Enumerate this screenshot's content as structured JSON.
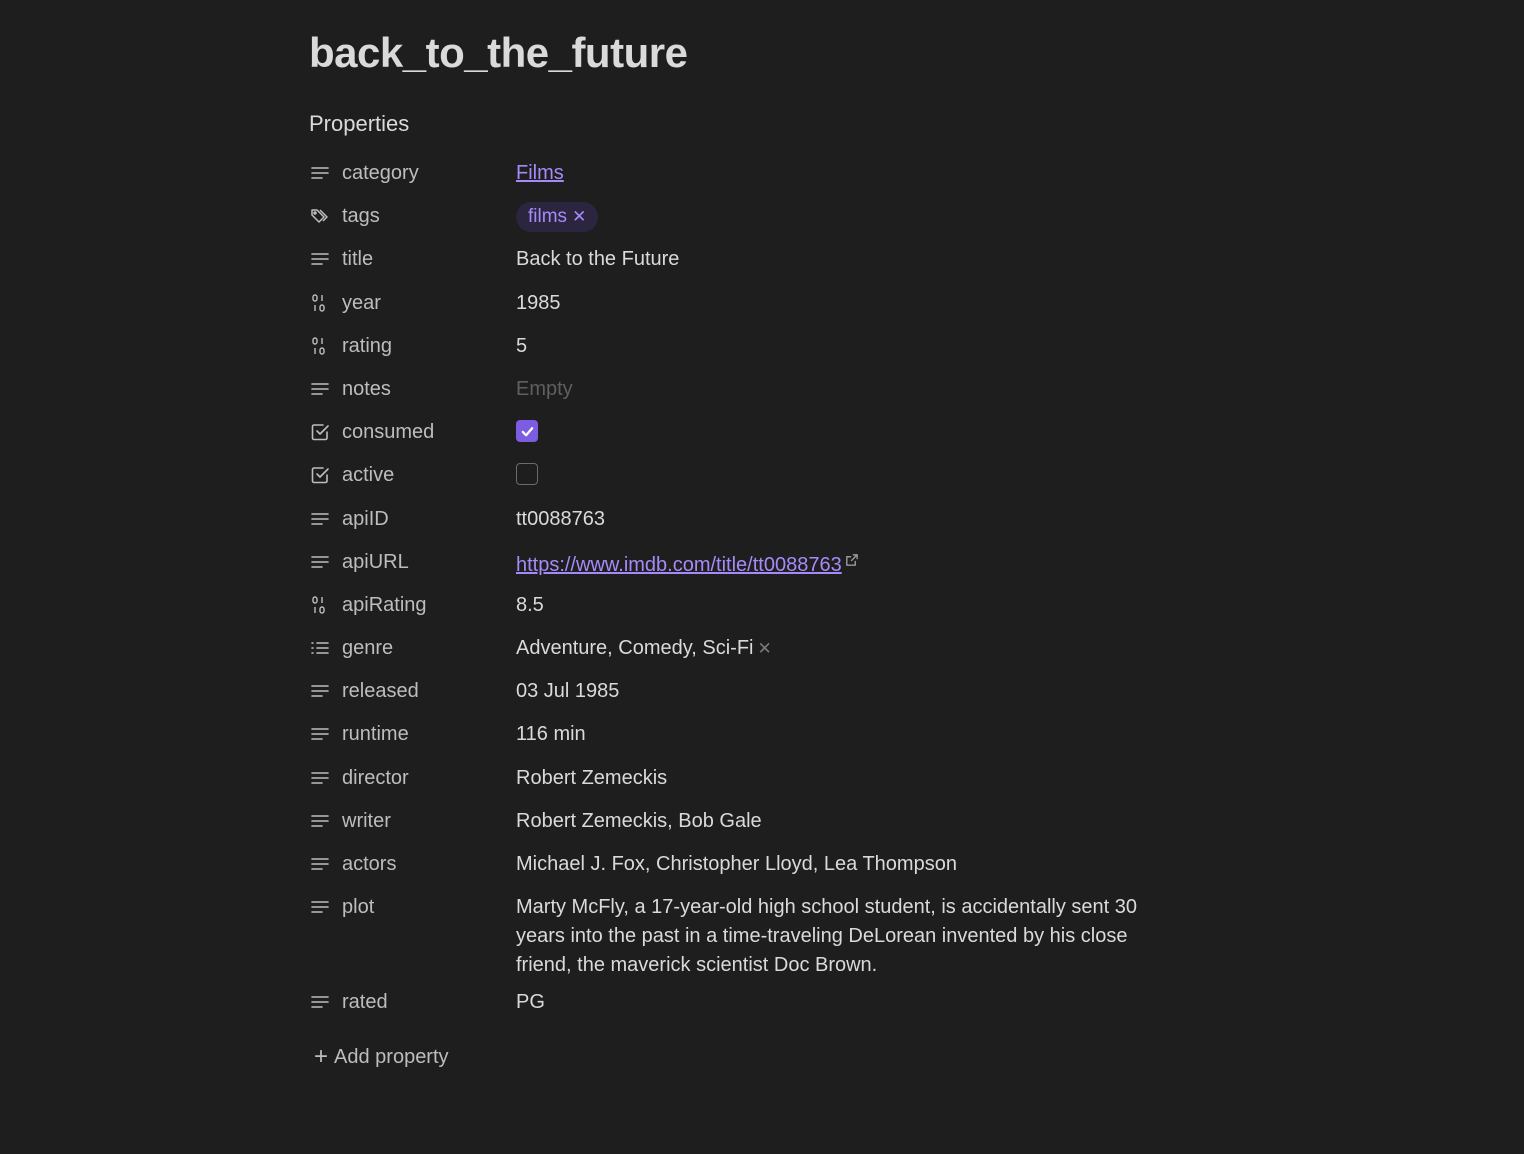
{
  "note": {
    "title": "back_to_the_future",
    "properties_heading": "Properties",
    "add_property_label": "Add property"
  },
  "properties": [
    {
      "key": "category",
      "icon": "text-lines-icon",
      "type": "link",
      "value": "Films"
    },
    {
      "key": "tags",
      "icon": "tags-icon",
      "type": "tag",
      "value": "films"
    },
    {
      "key": "title",
      "icon": "text-lines-icon",
      "type": "text",
      "value": "Back to the Future"
    },
    {
      "key": "year",
      "icon": "number-icon",
      "type": "text",
      "value": "1985"
    },
    {
      "key": "rating",
      "icon": "number-icon",
      "type": "text",
      "value": "5"
    },
    {
      "key": "notes",
      "icon": "text-lines-icon",
      "type": "empty",
      "value": "Empty"
    },
    {
      "key": "consumed",
      "icon": "checkbox-icon",
      "type": "checkbox",
      "checked": true
    },
    {
      "key": "active",
      "icon": "checkbox-icon",
      "type": "checkbox",
      "checked": false
    },
    {
      "key": "apiID",
      "icon": "text-lines-icon",
      "type": "text",
      "value": "tt0088763"
    },
    {
      "key": "apiURL",
      "icon": "text-lines-icon",
      "type": "url",
      "value": "https://www.imdb.com/title/tt0088763"
    },
    {
      "key": "apiRating",
      "icon": "number-icon",
      "type": "text",
      "value": "8.5"
    },
    {
      "key": "genre",
      "icon": "list-icon",
      "type": "multi",
      "value": "Adventure, Comedy, Sci-Fi"
    },
    {
      "key": "released",
      "icon": "text-lines-icon",
      "type": "text",
      "value": "03 Jul 1985"
    },
    {
      "key": "runtime",
      "icon": "text-lines-icon",
      "type": "text",
      "value": "116 min"
    },
    {
      "key": "director",
      "icon": "text-lines-icon",
      "type": "text",
      "value": "Robert Zemeckis"
    },
    {
      "key": "writer",
      "icon": "text-lines-icon",
      "type": "text",
      "value": "Robert Zemeckis, Bob Gale"
    },
    {
      "key": "actors",
      "icon": "text-lines-icon",
      "type": "text",
      "value": "Michael J. Fox, Christopher Lloyd, Lea Thompson"
    },
    {
      "key": "plot",
      "icon": "text-lines-icon",
      "type": "longtext",
      "value": "Marty McFly, a 17-year-old high school student, is accidentally sent 30 years into the past in a time-traveling DeLorean invented by his close friend, the maverick scientist Doc Brown."
    },
    {
      "key": "rated",
      "icon": "text-lines-icon",
      "type": "text",
      "value": "PG"
    }
  ],
  "colors": {
    "background": "#1e1e1e",
    "accent": "#a68af9",
    "checkbox_fill": "#7c5ce0",
    "tag_background": "#2b2540",
    "muted_text": "#bdbdbd"
  }
}
